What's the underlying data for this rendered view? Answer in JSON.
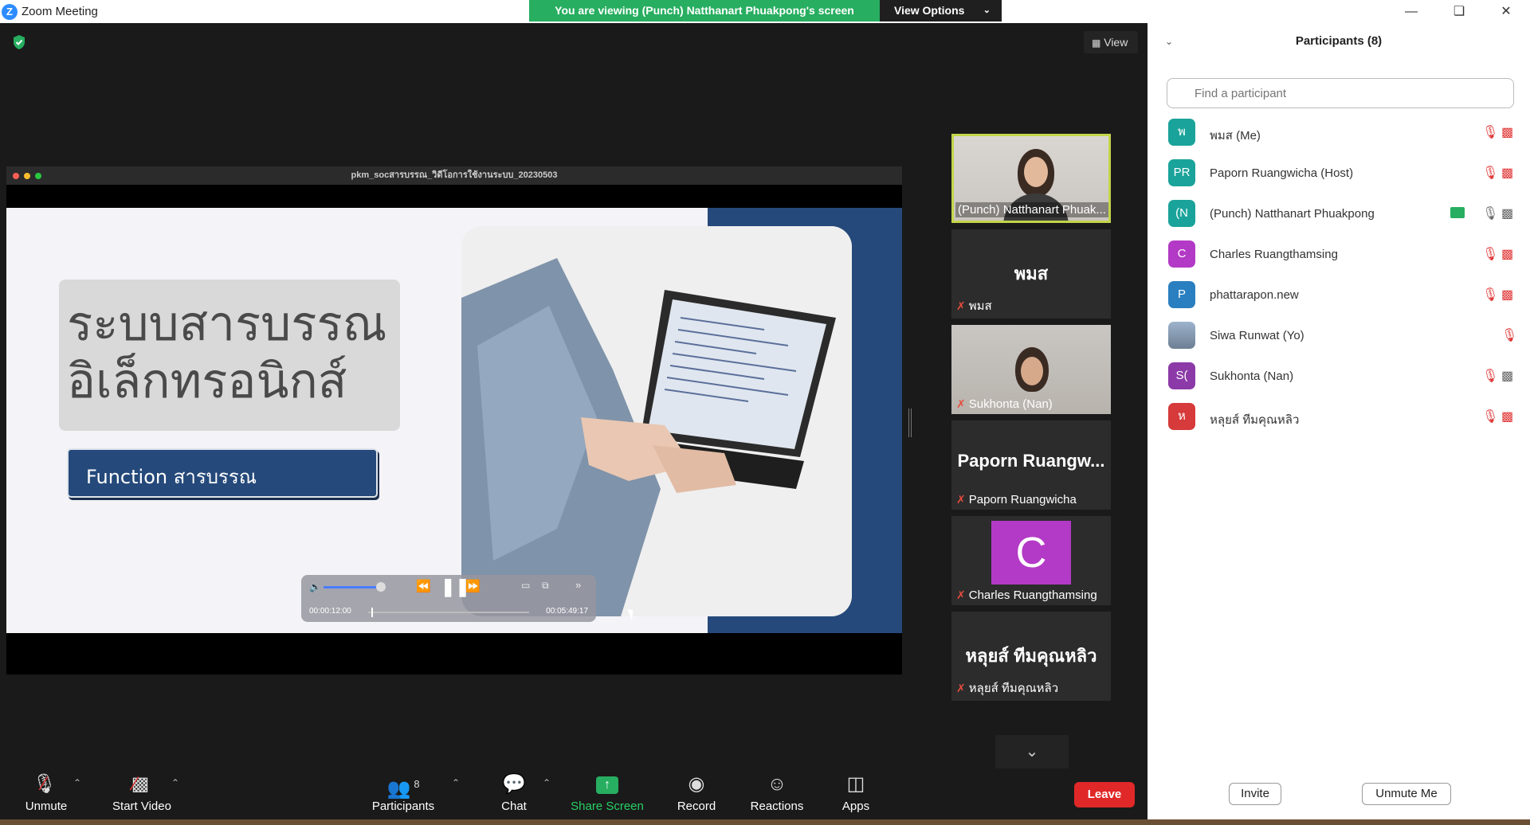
{
  "window": {
    "title": "Zoom Meeting"
  },
  "banner": {
    "text": "You are viewing (Punch) Natthanart Phuakpong's screen",
    "view_options": "View Options"
  },
  "meeting": {
    "view_label": "View"
  },
  "share": {
    "window_title": "pkm_socสารบรรณ_วิดีโอการใช้งานระบบ_20230503",
    "slide_title_line1": "ระบบสารบรรณ",
    "slide_title_line2": "อิเล็กทรอนิกส์",
    "slide_button": "Function สารบรรณ",
    "player_elapsed": "00:00:12:00",
    "player_total": "00:05:49:17"
  },
  "gallery": [
    {
      "name": "(Punch) Natthanart Phuak...",
      "type": "video"
    },
    {
      "big": "พมส",
      "name": "พมส",
      "type": "name"
    },
    {
      "name": "Sukhonta (Nan)",
      "type": "video"
    },
    {
      "big": "Paporn Ruangw...",
      "name": "Paporn Ruangwicha",
      "type": "name"
    },
    {
      "avatar": "C",
      "name": "Charles Ruangthamsing",
      "type": "avatar"
    },
    {
      "big": "หลุยส์ ทีมคุณหลิว",
      "name": "หลุยส์ ทีมคุณหลิว",
      "type": "name"
    }
  ],
  "toolbar": {
    "unmute": "Unmute",
    "start_video": "Start Video",
    "participants": "Participants",
    "participants_count": "8",
    "chat": "Chat",
    "share_screen": "Share Screen",
    "record": "Record",
    "reactions": "Reactions",
    "apps": "Apps",
    "leave": "Leave"
  },
  "panel": {
    "title": "Participants (8)",
    "search_placeholder": "Find a participant",
    "invite": "Invite",
    "unmute_me": "Unmute Me",
    "participants": [
      {
        "initials": "พ",
        "name": "พมส (Me)",
        "color": "#1aa39a"
      },
      {
        "initials": "PR",
        "name": "Paporn Ruangwicha (Host)",
        "color": "#1aa39a"
      },
      {
        "initials": "(N",
        "name": "(Punch) Natthanart Phuakpong",
        "color": "#1aa39a"
      },
      {
        "initials": "C",
        "name": "Charles Ruangthamsing",
        "color": "#b33ac6"
      },
      {
        "initials": "P",
        "name": "phattarapon.new",
        "color": "#2a7fc0"
      },
      {
        "initials": "",
        "name": "Siwa Runwat (Yo)",
        "color": "#8aa0b8"
      },
      {
        "initials": "S(",
        "name": "Sukhonta (Nan)",
        "color": "#8b3aa8"
      },
      {
        "initials": "ห",
        "name": "หลุยส์ ทีมคุณหลิว",
        "color": "#d63a3a"
      }
    ]
  },
  "colors": {
    "banner": "#27ae60",
    "leave": "#e02828",
    "active_speaker": "#c3d54a",
    "muted": "#e03434"
  }
}
